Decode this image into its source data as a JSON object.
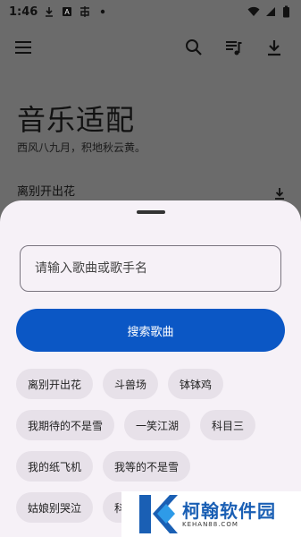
{
  "status_bar": {
    "time": "1:46",
    "icons_left": [
      "download-icon",
      "app-a-icon",
      "app-b-icon",
      "dot-icon"
    ],
    "icons_right": [
      "wifi-icon",
      "signal-icon",
      "battery-icon"
    ]
  },
  "app_bar": {
    "actions": [
      "search-icon",
      "queue-music-icon",
      "download-icon"
    ]
  },
  "page": {
    "title": "音乐适配",
    "subtitle": "西风八九月，积地秋云黄。",
    "first_song": "离别开出花"
  },
  "sheet": {
    "search_placeholder": "请输入歌曲或歌手名",
    "search_value": "",
    "search_button": "搜索歌曲",
    "chips": [
      [
        "离别开出花",
        "斗兽场",
        "钵钵鸡"
      ],
      [
        "我期待的不是雪",
        "一笑江湖",
        "科目三"
      ],
      [
        "我的纸飞机",
        "我等的不是雪"
      ],
      [
        "姑娘别哭泣",
        "科"
      ]
    ]
  },
  "watermark": {
    "name": "柯翰软件园",
    "domain": "KEHAN88.COM"
  },
  "colors": {
    "scrim": "#6b6b6b",
    "sheet": "#f6f1f7",
    "primary": "#0b57c5",
    "chip": "#e7e1e9",
    "watermark_blue": "#1a5fb4"
  }
}
